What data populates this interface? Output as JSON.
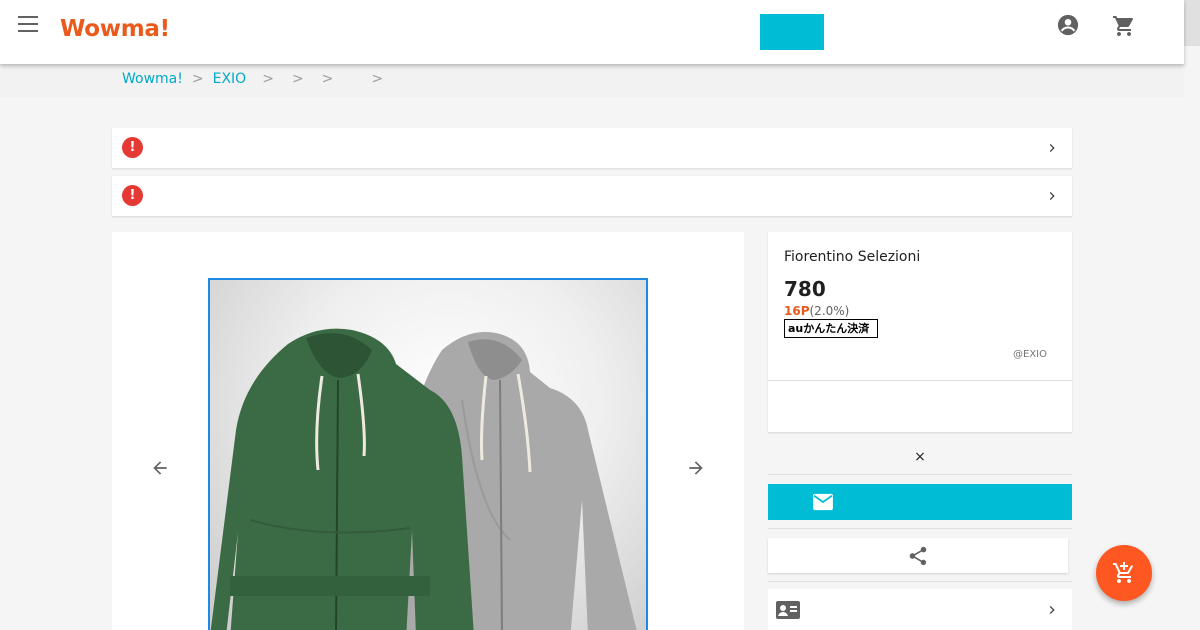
{
  "header": {
    "logo": "Wowma!",
    "icons": {
      "menu": "menu-icon",
      "account": "account-circle-icon",
      "cart": "shopping-cart-icon"
    },
    "accent_color": "#00bcd4",
    "brand_color": "#ea5a1c"
  },
  "breadcrumb": {
    "items": [
      "Wowma!",
      "EXIO"
    ],
    "separator": ">"
  },
  "notices": [
    {
      "icon": "alert-icon",
      "icon_glyph": "!"
    },
    {
      "icon": "alert-icon",
      "icon_glyph": "!"
    }
  ],
  "gallery": {
    "image": "hoodies-photo",
    "prev_icon": "arrow-left-icon",
    "next_icon": "arrow-right-icon"
  },
  "product": {
    "shop_name": "Fiorentino Selezioni",
    "price": "780",
    "points": "16P",
    "points_rate": "(2.0%)",
    "payment_badge": "auかんたん決済",
    "shop_tag": "@EXIO"
  },
  "quantity": {
    "close_symbol": "×"
  },
  "actions": {
    "mail_icon": "mail-icon",
    "share_icon": "share-icon",
    "contact_icon": "contact-card-icon",
    "fab_icon": "add-to-cart-icon"
  }
}
